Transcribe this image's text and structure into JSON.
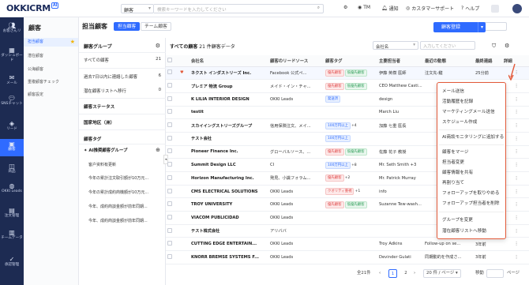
{
  "topbar": {
    "logo": "OKKICRM",
    "logo_badge": "AI",
    "search_scope": "顧客",
    "search_placeholder": "検索キーワードを入力してください",
    "tm": "TM",
    "notice": "通知",
    "support": "カスタマーサポート",
    "help": "ヘルプ"
  },
  "sidebar": [
    {
      "icon": "users-icon",
      "label": "お客さんリ"
    },
    {
      "icon": "dashboard-icon",
      "label": "ダッシュボード"
    },
    {
      "icon": "mail-icon",
      "label": "メール"
    },
    {
      "icon": "sns-icon",
      "label": "SNSチャット"
    },
    {
      "icon": "lead-icon",
      "label": "リード"
    },
    {
      "icon": "customer-icon",
      "label": "顧客"
    },
    {
      "icon": "product-icon",
      "label": "商品"
    },
    {
      "icon": "okki-leads-icon",
      "label": "OKKI Leads"
    },
    {
      "icon": "order-icon",
      "label": "注文管理"
    },
    {
      "icon": "team-icon",
      "label": "チームデータ"
    },
    {
      "icon": "approval-icon",
      "label": "承認管理"
    }
  ],
  "leftnav": {
    "title": "顧客",
    "items": [
      "担当顧客",
      "潜在顧客",
      "公海顧客",
      "重複顧客チェック",
      "顧客設定"
    ]
  },
  "main": {
    "title": "担当顧客",
    "tabs": [
      "担当顧客",
      "チーム顧客"
    ],
    "register_btn": "顧客登録"
  },
  "groups": {
    "header": "顧客グループ",
    "items": [
      {
        "label": "すべての顧客",
        "count": "21"
      },
      {
        "label": "過去7日以内に連絡した顧客",
        "count": "6"
      },
      {
        "label": "潜在顧客リストへ移行",
        "count": "0"
      }
    ],
    "sections": [
      "顧客ステータス",
      "国家地区（洲）",
      "顧客タグ"
    ],
    "ai_header": "AI推奨顧客グループ",
    "ai_items": [
      "客户资料有更新",
      "今年の累計注文取引額が10万元...",
      "今年の累計成約商機額が10万元...",
      "今年、成約商談金額が前年同期...",
      "今年、成約商談金額が前年同期..."
    ]
  },
  "grid": {
    "all_label": "すべての顧客",
    "count_text": "21 件顧客データ",
    "sort_select": "会社名",
    "search_placeholder": "入力してください",
    "columns": [
      "",
      "",
      "会社名",
      "顧客のリードソース",
      "顧客タグ",
      "主要担当者",
      "最近の動態",
      "最終連絡",
      "詳細"
    ],
    "rows": [
      [
        "ネクスト インダストリーズ Inc.",
        "Facebook 公式ペ...",
        "優先顧客|低優先顧客",
        "伊藤 英樹 医師",
        "注文先-鍵",
        "25分前"
      ],
      [
        "プレミア 物流 Group",
        "メイド・イン・チャ...",
        "優先顧客|低優先顧客",
        "CEO Matthew Casti...",
        "",
        ""
      ],
      [
        "K LILIA INTERIOR DESIGN",
        "OKKI Leads",
        "発送済",
        "design",
        "",
        ""
      ],
      [
        "testit",
        "",
        "",
        "March Liu",
        "",
        ""
      ],
      [
        "スカイイングストリーズグループ",
        "信用保険注文、メイ...",
        "100万円以上 +4",
        "加藤 七重 医長",
        "",
        ""
      ],
      [
        "テスト会社",
        "",
        "100万円以上",
        "",
        "",
        ""
      ],
      [
        "Pioneer Finance Inc.",
        "グローバルソース、...",
        "優先顧客|低優先顧客",
        "佐藤 花子 教授",
        "",
        ""
      ],
      [
        "Summit Design LLC",
        "CI",
        "100万円以上 +8",
        "Mr. Seth Smith +3",
        "",
        ""
      ],
      [
        "Horizon Manufacturing Inc.",
        "発見、小識フォラム...",
        "優先顧客 +2",
        "Mr. Patrick Murray",
        "",
        ""
      ],
      [
        "CMS ELECTRICAL SOLUTIONS",
        "OKKI Leads",
        "クオリティ重視 +1",
        "info",
        "",
        ""
      ],
      [
        "TROY UNIVERSITY",
        "OKKI Leads",
        "優先顧客|低優先顧客",
        "Suzanne Tew-wash...",
        "",
        ""
      ],
      [
        "VIACOM PUBLICIDAD",
        "OKKI Leads",
        "",
        "",
        "",
        ""
      ],
      [
        "テスト株式会社",
        "アリババ",
        "",
        "",
        "",
        ""
      ],
      [
        "CUTTING EDGE ENTERTAIN...",
        "OKKI Leads",
        "",
        "Troy Adkins",
        "Follow-up on se...",
        "3年前"
      ],
      [
        "KNORR BREMSE SYSTEMS F...",
        "OKKI Leads",
        "",
        "Devinder Gulati",
        "同期動的を作成さ...",
        "3年前"
      ]
    ]
  },
  "menu": {
    "group1": [
      "メール送信",
      "活動履歴を記録",
      "マーケティングメール送信",
      "スケジュール作成"
    ],
    "group2": [
      "AI商談モニタリングに追加する"
    ],
    "group3": [
      "顧客をマージ",
      "担当者変更",
      "顧客情報を共有",
      "再割り当て",
      "フォローアップを取りやめる",
      "フォローアップ担当者を削除"
    ],
    "group4": [
      "グループを変更",
      "潜在顧客リストへ移動"
    ]
  },
  "footer": {
    "total": "全21件",
    "pages": [
      "1",
      "2"
    ],
    "per_page": "20 件 / ページ",
    "goto": "移動",
    "page_unit": "ページ"
  },
  "colors": {
    "accent": "#2f6bff",
    "sidebar": "#1d2b52",
    "highlight": "#e35a3a"
  }
}
